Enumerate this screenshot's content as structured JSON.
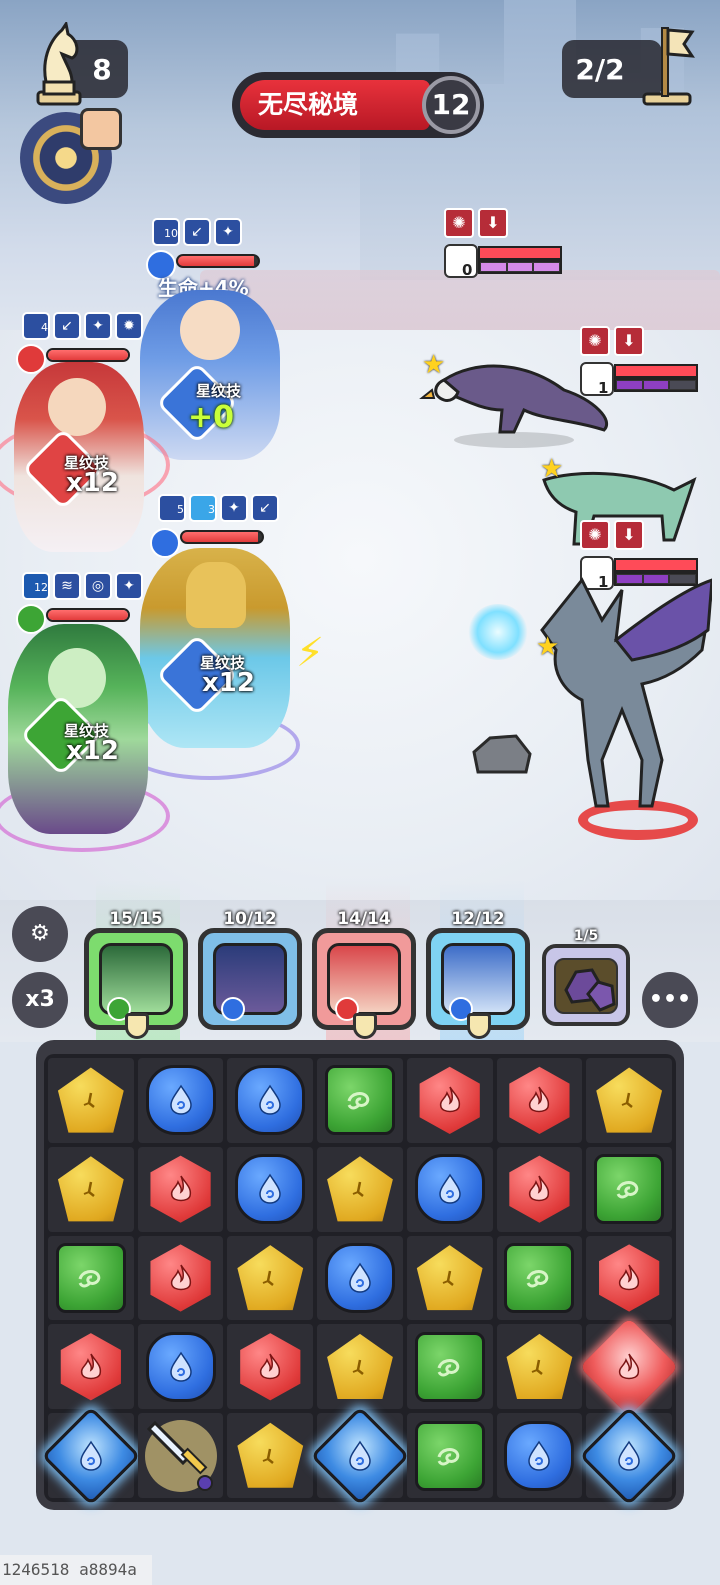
{
  "hud": {
    "knight_count": "8",
    "wave_progress": "2/2",
    "mode_title": "无尽秘境",
    "floor_number": "12"
  },
  "heroes": [
    {
      "name": "blue-haired-mage",
      "buff_stack": "10",
      "float_text": "生命+4%",
      "skill_label": "星纹技",
      "skill_gain": "+0",
      "element": "water",
      "hp": 0.95
    },
    {
      "name": "red-haired-priestess",
      "buff_stack": "4",
      "skill_label": "星纹技",
      "skill_multiplier": "x12",
      "element": "fire",
      "hp": 1.0
    },
    {
      "name": "golden-dragon-knight",
      "buff_stack": "5",
      "buff_stack_2": "3",
      "skill_label": "星纹技",
      "skill_multiplier": "x12",
      "element": "water",
      "hp": 0.95
    },
    {
      "name": "green-serpent-queen",
      "buff_stack": "12",
      "skill_label": "星纹技",
      "skill_multiplier": "x12",
      "element": "wood",
      "hp": 1.0
    }
  ],
  "enemies": [
    {
      "name": "griffin",
      "stun_turns": "0",
      "hp": 1.0,
      "charge": 3,
      "charge_max": 3
    },
    {
      "name": "spirit-wolf",
      "stun_turns": "1",
      "hp": 1.0,
      "charge": 2,
      "charge_max": 3
    },
    {
      "name": "dark-pegasus",
      "stun_turns": "1",
      "hp": 1.0,
      "charge": 2,
      "charge_max": 3
    }
  ],
  "team": {
    "speed_label": "x3",
    "slots": [
      {
        "name": "green-serpent-queen",
        "energy": "15/15",
        "element": "wood"
      },
      {
        "name": "golden-dragon-knight",
        "energy": "10/12",
        "element": "water"
      },
      {
        "name": "red-haired-priestess",
        "energy": "14/14",
        "element": "fire"
      },
      {
        "name": "blue-haired-mage",
        "energy": "12/12",
        "element": "water"
      }
    ],
    "ore_count": "1/5"
  },
  "board": {
    "rows": [
      [
        "earth",
        "water",
        "water",
        "wood",
        "fire",
        "fire",
        "earth"
      ],
      [
        "earth",
        "fire",
        "water",
        "earth",
        "water",
        "fire",
        "wood"
      ],
      [
        "wood",
        "fire",
        "earth",
        "water",
        "earth",
        "wood",
        "fire"
      ],
      [
        "fire",
        "water",
        "fire",
        "earth",
        "wood",
        "earth",
        "bright-fire"
      ],
      [
        "bright",
        "sword",
        "earth",
        "bright",
        "wood",
        "water",
        "bright"
      ]
    ]
  },
  "footer": {
    "build_id": "1246518 a8894a"
  },
  "colors": {
    "fire": "#e03a3a",
    "water": "#2f6ee0",
    "wood": "#3da535",
    "earth": "#e0a81f",
    "title_red": "#d0202c"
  }
}
